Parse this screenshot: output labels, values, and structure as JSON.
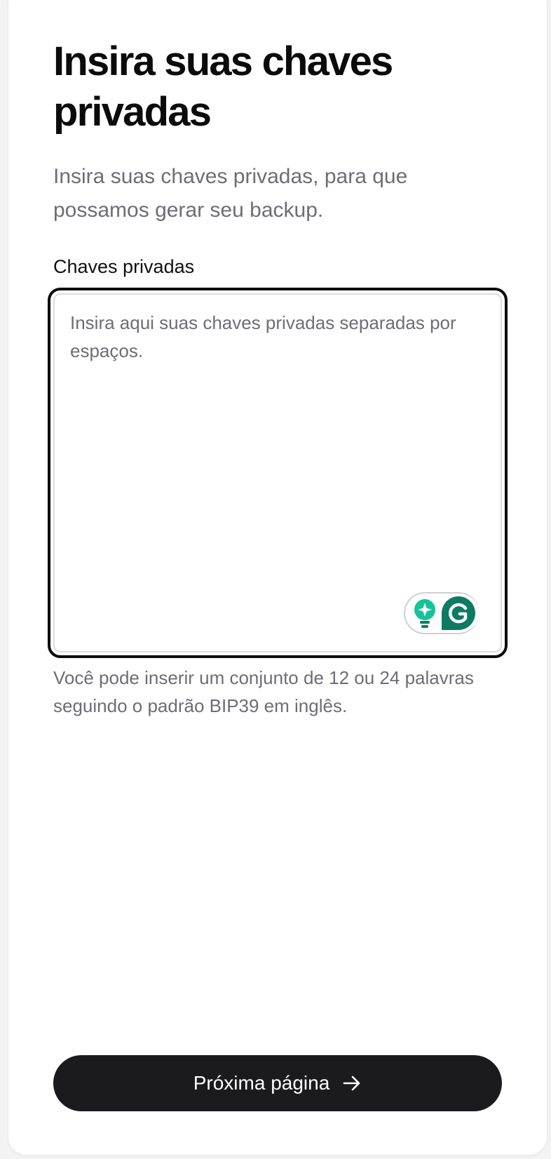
{
  "page": {
    "title": "Insira suas chaves privadas",
    "subtitle": "Insira suas chaves privadas, para que possamos gerar seu backup."
  },
  "form": {
    "label": "Chaves privadas",
    "value": "",
    "placeholder": "Insira aqui suas chaves privadas separadas por espaços.",
    "helper": "Você pode inserir um conjunto de 12 ou 24 palavras seguindo o padrão BIP39 em inglês."
  },
  "grammarly_widget": {
    "icons": [
      "lightbulb-icon",
      "grammarly-g-icon"
    ],
    "accent_light": "#15c39a",
    "accent_dark": "#0f7a63"
  },
  "footer": {
    "next_label": "Próxima página",
    "next_icon": "arrow-right-icon"
  },
  "colors": {
    "primary_text": "#0b0b0c",
    "muted_text": "#6d6d76",
    "button_bg": "#1b1b1d",
    "focus_border": "#0b0b0c"
  }
}
